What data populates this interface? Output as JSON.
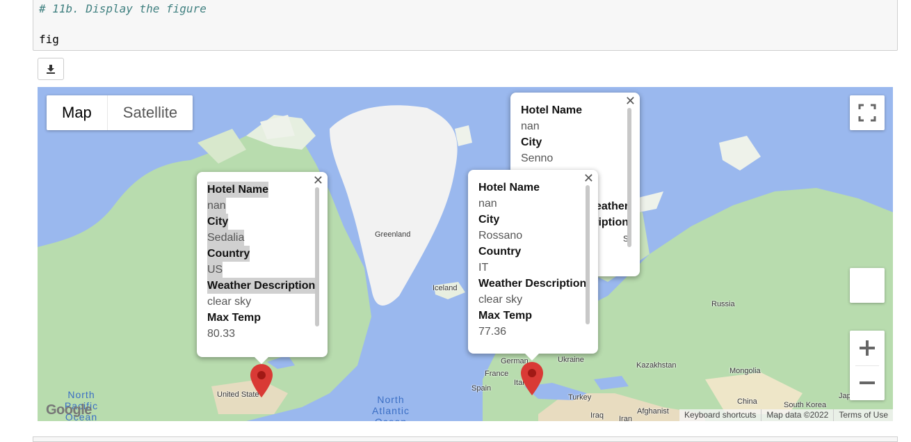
{
  "code_cell": {
    "comment": "# 11b. Display the figure",
    "code": "fig"
  },
  "download_icon": "download-icon",
  "map": {
    "type_controls": {
      "map": "Map",
      "satellite": "Satellite"
    },
    "labels": {
      "greenland": "Greenland",
      "iceland": "Iceland",
      "russia": "Russia",
      "kazakhstan": "Kazakhstan",
      "mongolia": "Mongolia",
      "germany": "German",
      "ukraine": "Ukraine",
      "france": "France",
      "spain": "Spain",
      "italy": "Ital",
      "turkey": "Turkey",
      "china": "China",
      "south_korea": "South Korea",
      "japan": "Japan",
      "iraq": "Iraq",
      "iran": "Iran",
      "afghanistan": "Afghanist",
      "united_states": "United State",
      "north_pacific": "North Pacific Ocean",
      "north_atlantic": "North Atlantic Ocean"
    },
    "attribution": {
      "keyboard": "Keyboard shortcuts",
      "data": "Map data ©2022",
      "terms": "Terms of Use"
    },
    "logo": "Google"
  },
  "info_windows": [
    {
      "fields": [
        {
          "key": "Hotel Name",
          "value": "nan"
        },
        {
          "key": "City",
          "value": "Senno"
        },
        {
          "key": "Weather Description",
          "value": "s"
        }
      ]
    },
    {
      "fields": [
        {
          "key": "Hotel Name",
          "value": "nan"
        },
        {
          "key": "City",
          "value": "Sedalia"
        },
        {
          "key": "Country",
          "value": "US"
        },
        {
          "key": "Weather Description",
          "value": "clear sky"
        },
        {
          "key": "Max Temp",
          "value": "80.33"
        }
      ]
    },
    {
      "fields": [
        {
          "key": "Hotel Name",
          "value": "nan"
        },
        {
          "key": "City",
          "value": "Rossano"
        },
        {
          "key": "Country",
          "value": "IT"
        },
        {
          "key": "Weather Description",
          "value": "clear sky"
        },
        {
          "key": "Max Temp",
          "value": "77.36"
        }
      ]
    }
  ],
  "colors": {
    "water": "#9ab8ee",
    "land": "#b8dcae",
    "ice": "#f2f2f2",
    "pin": "#d93a35"
  }
}
